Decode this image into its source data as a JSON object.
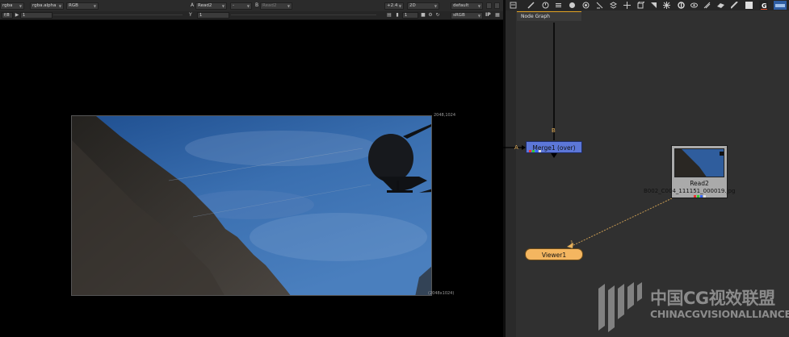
{
  "viewer": {
    "toolbar": {
      "channels": "rgba",
      "alpha_channel": "rgba.alpha",
      "colorspace_display": "RGB",
      "input_a_label": "A",
      "input_a_value": "Read2",
      "compare_mode": "-",
      "input_b_label": "B",
      "input_b_value": "Read2",
      "gain": "+2.4",
      "view_mode": "2D",
      "lut": "default",
      "fstop": "f/8",
      "frame": "1",
      "y_label": "Y",
      "y_value": "1",
      "gamma": "1",
      "view_transform": "sRGB",
      "ip_label": "IP"
    },
    "canvas": {
      "top_right_coords": "2048,1024",
      "bottom_right_coords": "(2048x1024)"
    }
  },
  "node_graph": {
    "tab_label": "Node Graph",
    "merge_node": {
      "label": "Merge1 (over)",
      "input_a": "A",
      "input_b": "B"
    },
    "read_node": {
      "label": "Read2",
      "filename": "B002_C004_111151_000019.jpg"
    },
    "viewer_node": {
      "label": "Viewer1",
      "input_index": "1"
    }
  },
  "watermark": {
    "chinese": "中国CG视效联盟",
    "english": "CHINACGVISIONALLIANCE"
  },
  "colors": {
    "merge_node": "#5c77d8",
    "viewer_node": "#f4b660",
    "read_node": "#aaaaaa",
    "pipe": "#000000",
    "viewer_pipe": "#c79a52"
  }
}
